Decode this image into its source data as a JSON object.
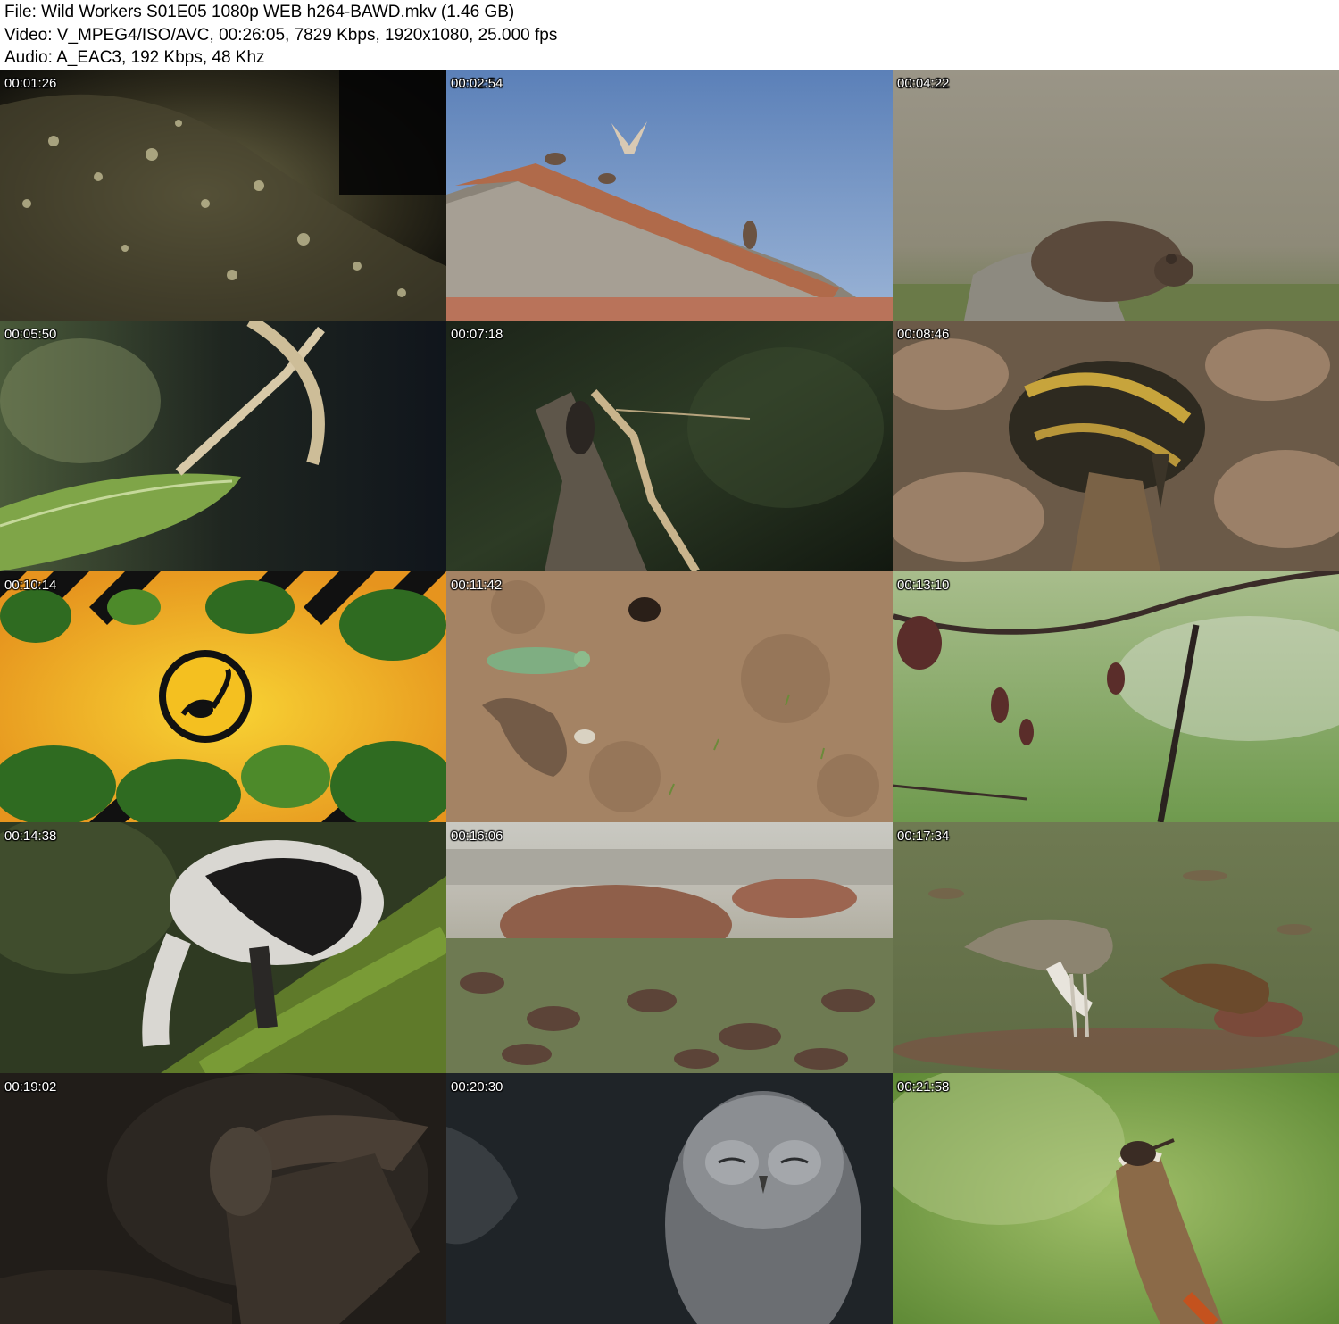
{
  "header": {
    "file_line": "File: Wild Workers S01E05 1080p WEB h264-BAWD.mkv (1.46 GB)",
    "video_line": "Video: V_MPEG4/ISO/AVC, 00:26:05, 7829 Kbps, 1920x1080, 25.000 fps",
    "audio_line": "Audio: A_EAC3, 192 Kbps, 48 Khz"
  },
  "thumbnails": [
    {
      "timestamp": "00:01:26"
    },
    {
      "timestamp": "00:02:54"
    },
    {
      "timestamp": "00:04:22"
    },
    {
      "timestamp": "00:05:50"
    },
    {
      "timestamp": "00:07:18"
    },
    {
      "timestamp": "00:08:46"
    },
    {
      "timestamp": "00:10:14"
    },
    {
      "timestamp": "00:11:42"
    },
    {
      "timestamp": "00:13:10"
    },
    {
      "timestamp": "00:14:38"
    },
    {
      "timestamp": "00:16:06"
    },
    {
      "timestamp": "00:17:34"
    },
    {
      "timestamp": "00:19:02"
    },
    {
      "timestamp": "00:20:30"
    },
    {
      "timestamp": "00:21:58"
    }
  ]
}
